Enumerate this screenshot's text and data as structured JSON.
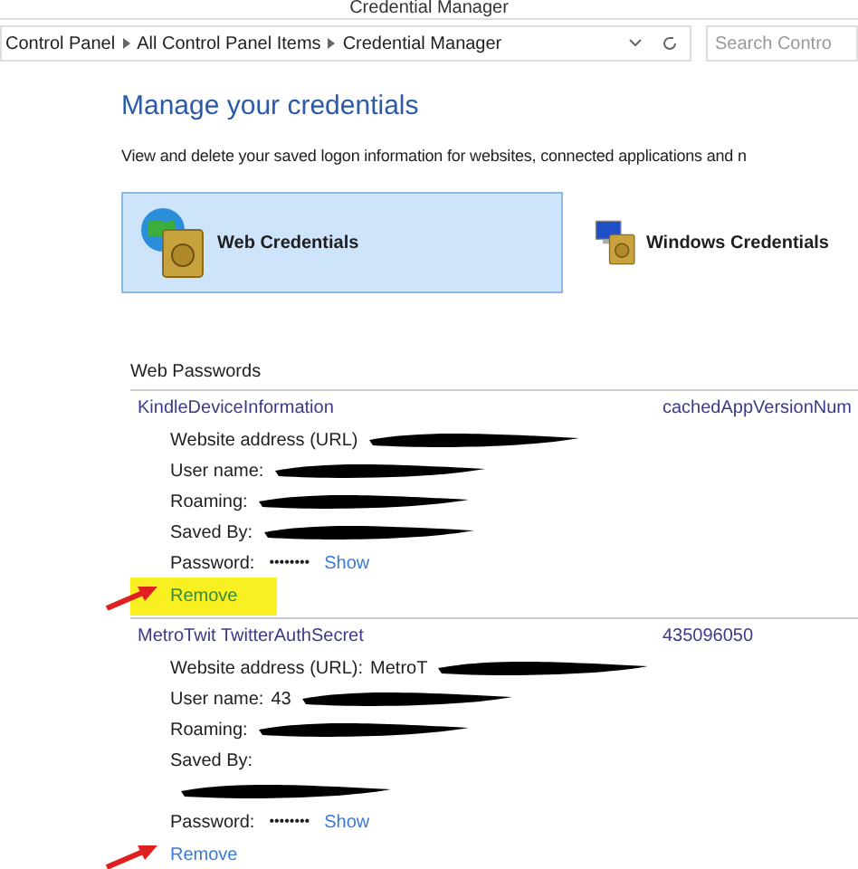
{
  "window": {
    "title": "Credential Manager"
  },
  "breadcrumbs": [
    "Control Panel",
    "All Control Panel Items",
    "Credential Manager"
  ],
  "search": {
    "placeholder": "Search Contro"
  },
  "heading": "Manage your credentials",
  "description": "View and delete your saved logon information for websites, connected applications and n",
  "credential_types": [
    {
      "label": "Web Credentials",
      "kind": "web",
      "selected": true
    },
    {
      "label": "Windows Credentials",
      "kind": "windows",
      "selected": false
    }
  ],
  "section_title": "Web Passwords",
  "entries": [
    {
      "name": "KindleDeviceInformation",
      "column_2": "cachedAppVersionNum",
      "fields": [
        {
          "label": "Website address (URL)",
          "redacted": true
        },
        {
          "label": "User name:",
          "redacted": true
        },
        {
          "label": "Roaming:",
          "redacted": true
        },
        {
          "label": "Saved By:",
          "redacted": true
        }
      ],
      "password": {
        "label": "Password:",
        "mask": "••••••••",
        "link": "Show"
      },
      "remove": {
        "label": "Remove",
        "highlighted": true,
        "arrow": true
      }
    },
    {
      "name": "MetroTwit TwitterAuthSecret",
      "column_2": "435096050",
      "fields": [
        {
          "label": "Website address (URL):",
          "value": "MetroT",
          "redacted": true
        },
        {
          "label": "User name:",
          "value": "43",
          "redacted": true
        },
        {
          "label": "Roaming:",
          "redacted": true
        },
        {
          "label": "Saved By:"
        },
        {
          "redacted": true
        }
      ],
      "password": {
        "label": "Password:",
        "mask": "••••••••",
        "link": "Show"
      },
      "remove": {
        "label": "Remove",
        "highlighted": false,
        "arrow": true
      }
    }
  ]
}
